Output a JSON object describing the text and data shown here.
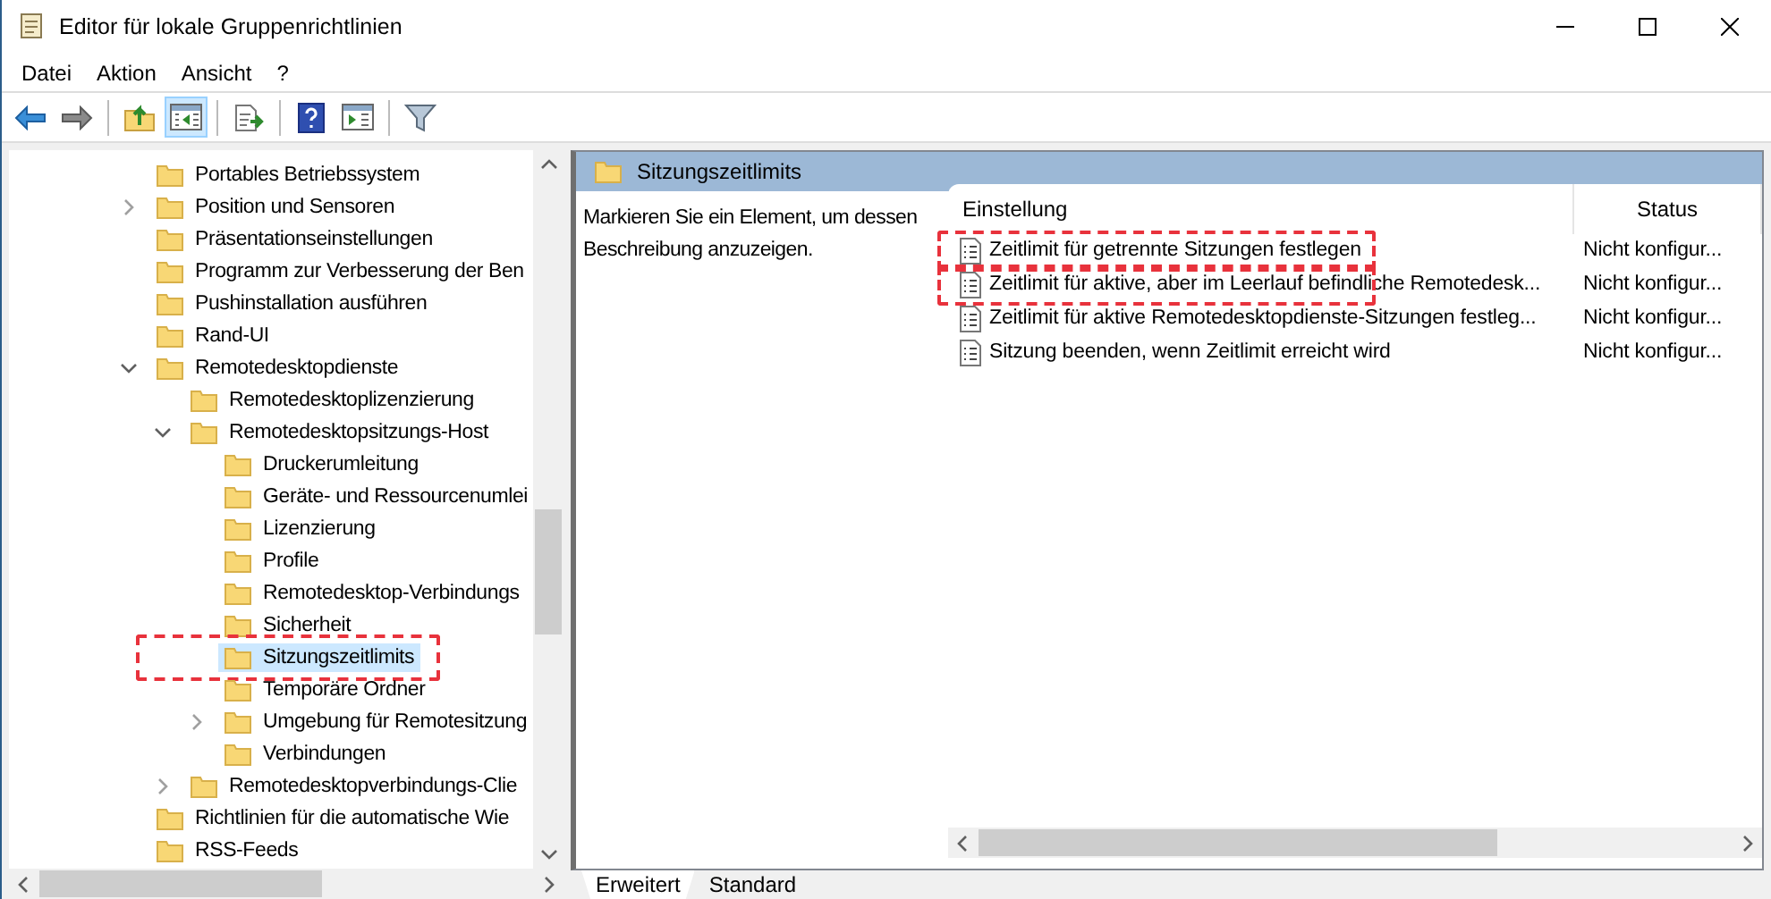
{
  "window": {
    "title": "Editor für lokale Gruppenrichtlinien"
  },
  "menu": [
    "Datei",
    "Aktion",
    "Ansicht",
    "?"
  ],
  "toolbar": [
    {
      "kind": "back",
      "pressed": false
    },
    {
      "kind": "forward",
      "pressed": false
    },
    {
      "kind": "sep"
    },
    {
      "kind": "up",
      "pressed": false
    },
    {
      "kind": "tree",
      "pressed": true
    },
    {
      "kind": "sep"
    },
    {
      "kind": "export",
      "pressed": false
    },
    {
      "kind": "sep"
    },
    {
      "kind": "help",
      "pressed": false
    },
    {
      "kind": "pane",
      "pressed": false
    },
    {
      "kind": "sep"
    },
    {
      "kind": "filter",
      "pressed": false
    }
  ],
  "tree": [
    {
      "label": "Portables Betriebssystem",
      "selected": false
    },
    {
      "label": "Position und Sensoren",
      "expanded": false,
      "selected": false
    },
    {
      "label": "Präsentationseinstellungen",
      "selected": false
    },
    {
      "label": "Programm zur Verbesserung der Ben",
      "selected": false
    },
    {
      "label": "Pushinstallation ausführen",
      "selected": false
    },
    {
      "label": "Rand-UI",
      "selected": false
    },
    {
      "label": "Remotedesktopdienste",
      "expanded": true,
      "selected": false,
      "children": [
        {
          "label": "Remotedesktoplizenzierung",
          "selected": false
        },
        {
          "label": "Remotedesktopsitzungs-Host",
          "expanded": true,
          "selected": false,
          "children": [
            {
              "label": "Druckerumleitung",
              "selected": false
            },
            {
              "label": "Geräte- und Ressourcenumlei",
              "selected": false
            },
            {
              "label": "Lizenzierung",
              "selected": false
            },
            {
              "label": "Profile",
              "selected": false
            },
            {
              "label": "Remotedesktop-Verbindungs",
              "selected": false
            },
            {
              "label": "Sicherheit",
              "selected": false
            },
            {
              "label": "Sitzungszeitlimits",
              "selected": true,
              "highlighted": true
            },
            {
              "label": "Temporäre Ordner",
              "selected": false
            },
            {
              "label": "Umgebung für Remotesitzung",
              "expanded": false,
              "selected": false
            },
            {
              "label": "Verbindungen",
              "selected": false
            }
          ]
        },
        {
          "label": "Remotedesktopverbindungs-Clie",
          "expanded": false,
          "selected": false
        }
      ]
    },
    {
      "label": "Richtlinien für die automatische Wie",
      "selected": false
    },
    {
      "label": "RSS-Feeds",
      "selected": false
    }
  ],
  "details": {
    "header": "Sitzungszeitlimits",
    "description": "Markieren Sie ein Element, um dessen Beschreibung anzuzeigen.",
    "columns": [
      "Einstellung",
      "Status"
    ],
    "rows": [
      {
        "setting": "Zeitlimit für getrennte Sitzungen festlegen",
        "status": "Nicht konfigur...",
        "highlighted": true
      },
      {
        "setting": "Zeitlimit für aktive, aber im Leerlauf befindliche Remotedesk...",
        "status": "Nicht konfigur...",
        "highlighted": true
      },
      {
        "setting": "Zeitlimit für aktive Remotedesktopdienste-Sitzungen festleg...",
        "status": "Nicht konfigur...",
        "highlighted": false
      },
      {
        "setting": "Sitzung beenden, wenn Zeitlimit erreicht wird",
        "status": "Nicht konfigur...",
        "highlighted": false
      }
    ]
  },
  "tabs": [
    {
      "label": "Erweitert",
      "selected": true
    },
    {
      "label": "Standard",
      "selected": false
    }
  ]
}
